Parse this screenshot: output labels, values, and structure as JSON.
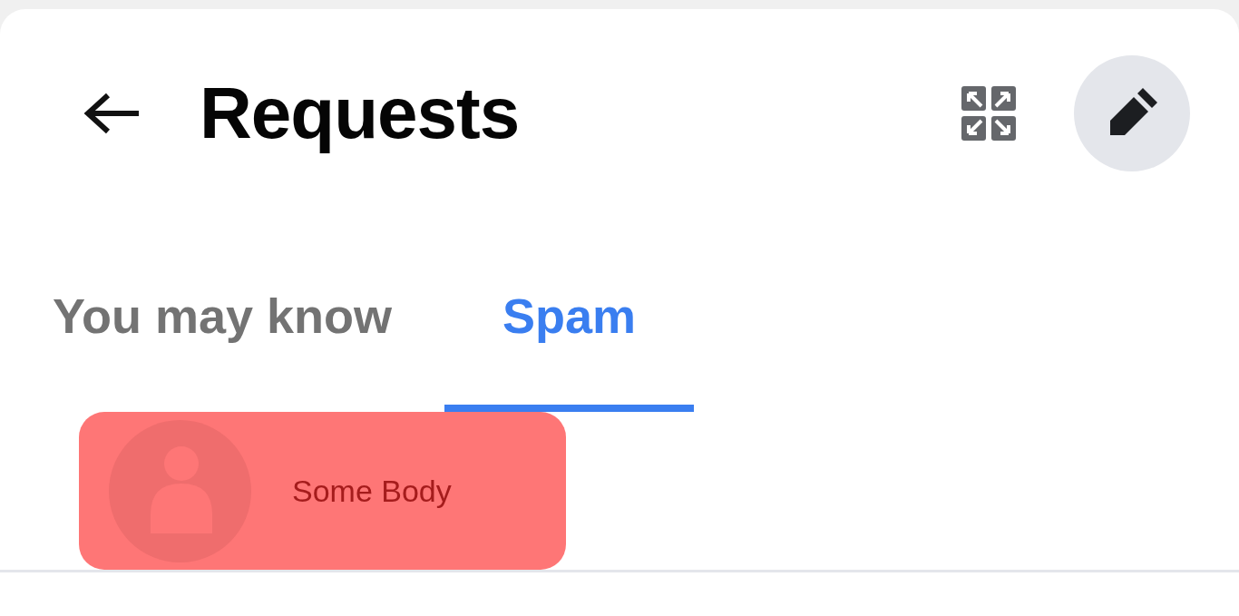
{
  "header": {
    "title": "Requests"
  },
  "tabs": [
    {
      "label": "You may know",
      "selected": false
    },
    {
      "label": "Spam",
      "selected": true
    }
  ],
  "requests": [
    {
      "name": "Some Body",
      "highlighted": true
    }
  ]
}
